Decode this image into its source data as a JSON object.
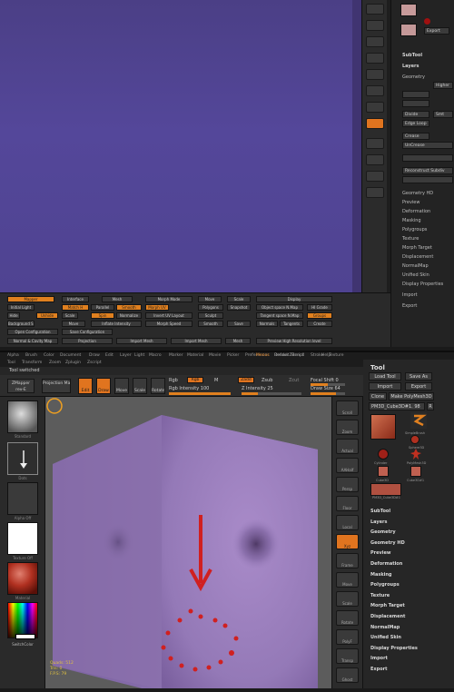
{
  "top": {
    "viewport_color": "#51448f",
    "tray_buttons": [
      "",
      "",
      "",
      "",
      "",
      "",
      "",
      "",
      "",
      "",
      "",
      "",
      "",
      "",
      "",
      "",
      "",
      "",
      "",
      "",
      ""
    ],
    "panel": {
      "subtool": "SubTool",
      "layers": "Layers",
      "geometry": "Geometry",
      "higher": "Higher",
      "divide": "Divide",
      "smt": "Smt",
      "edge_loop": "Edge Loop",
      "crease": "Crease",
      "uncrease": "UnCrease",
      "reconstruct": "Reconstruct Subdiv",
      "geometry_hd": "Geometry HD",
      "preview": "Preview",
      "deformation": "Deformation",
      "masking": "Masking",
      "polygroups": "Polygroups",
      "texture": "Texture",
      "morph_target": "Morph Target",
      "displacement": "Displacement",
      "normalmap": "NormalMap",
      "unified_skin": "Unified Skin",
      "display_properties": "Display Properties",
      "import": "Import",
      "export": "Export"
    },
    "toolbar": {
      "row1": [
        "Mapper",
        "Interface",
        "Mesh",
        "Morph Mode",
        "Move",
        "Scale",
        "Display"
      ],
      "row2": [
        "Initial Light",
        "Match H",
        "Parallel",
        "Smooth",
        "Morph UV",
        "Polygons",
        "Snapshot",
        "Object space N.Map",
        "HI Grade"
      ],
      "row3": [
        "Hide",
        "Unhide",
        "Scale",
        "Spin",
        "Normalize",
        "Invert UV Layout",
        "Sculpt",
        "Tangent space N.Map",
        "Groups"
      ],
      "row4": [
        "Background Shader",
        "Move",
        "Inflate Intensity",
        "Morph Speed",
        "Smooth",
        "Save",
        "Normals",
        "Tangents",
        "Create"
      ],
      "row5": [
        "Open Configuration",
        "Save Configuration"
      ],
      "row6": [
        "Normal & Cavity Map",
        "Projection",
        "Import Mesh",
        "Import Mesh",
        "Mesh",
        "Preview High Resolution level"
      ]
    }
  },
  "bottom": {
    "menubar": [
      "Alpha",
      "Brush",
      "Color",
      "Document",
      "Draw",
      "Edit",
      "Layer",
      "Light",
      "Macro",
      "Marker",
      "Material",
      "Movie",
      "Picker",
      "Preferences",
      "Render",
      "Stencil",
      "Stroke",
      "Texture"
    ],
    "menubar_right": [
      "Menus",
      "DefaultZScript",
      "Help"
    ],
    "menubar2": [
      "Tool",
      "Transform",
      "Zoom",
      "Zplugin",
      "Zscript"
    ],
    "status_msg": "Tool switched",
    "shelf": {
      "zmapper": "ZMapper",
      "zmapper_sub": "rev-E",
      "projection_master": "Projection Master",
      "edit": "Edit",
      "draw": "Draw",
      "move": "Move",
      "scale": "Scale",
      "rotate": "Rotate",
      "rgb": "Rgb",
      "m": "M",
      "rgb_intensity": "Rgb Intensity 100",
      "zadd": "Zadd",
      "zsub": "Zsub",
      "zcut": "Zcut",
      "z_intensity": "Z Intensity 25",
      "focal_shift": "Focal Shift 0",
      "draw_size": "Draw Size 64"
    },
    "left_labels": [
      "Standard",
      "Dots",
      "Alpha Off",
      "Texture Off",
      "Material",
      "SwitchColor"
    ],
    "stats": [
      "Quads: 512",
      "Tris: 0",
      "F.P.S: 79"
    ],
    "right_tray": [
      "Scroll",
      "Zoom",
      "Actual",
      "AAHalf",
      "Persp",
      "Floor",
      "Local",
      "Xyz",
      "Frame",
      "Move",
      "Scale",
      "Rotate",
      "PolyF",
      "Transp",
      "Ghost"
    ],
    "tool": {
      "title": "Tool",
      "load_tool": "Load Tool",
      "save_as": "Save As",
      "import": "Import",
      "export": "Export",
      "clone": "Clone",
      "make_polymesh": "Make PolyMesh3D",
      "current": "PM3D_Cube3D#1. 98",
      "current_r": "R",
      "tools": [
        "SimpleBrush",
        "Sphere3D",
        "Cylinder",
        "PolyMesh3D",
        "Cube3D",
        "Cube3D#1",
        "PM3D_Cube3D#1"
      ],
      "items": [
        "SubTool",
        "Layers",
        "Geometry",
        "Geometry HD",
        "Preview",
        "Deformation",
        "Masking",
        "Polygroups",
        "Texture",
        "Morph Target",
        "Displacement",
        "NormalMap",
        "Unified Skin",
        "Display Properties",
        "Import",
        "Export"
      ]
    },
    "cube_color": "#9a80bf",
    "arrow_color": "#d02020"
  }
}
